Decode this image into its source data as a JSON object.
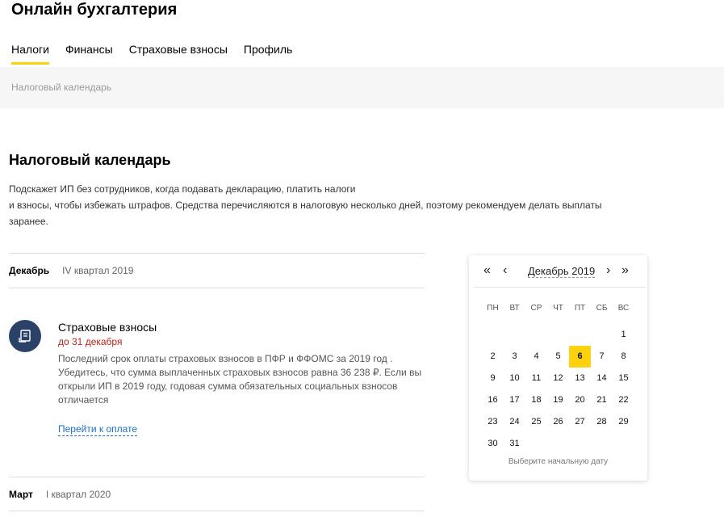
{
  "app": {
    "title": "Онлайн бухгалтерия"
  },
  "tabs": [
    {
      "label": "Налоги",
      "active": true
    },
    {
      "label": "Финансы"
    },
    {
      "label": "Страховые взносы"
    },
    {
      "label": "Профиль"
    }
  ],
  "breadcrumb": "Налоговый календарь",
  "page": {
    "title": "Налоговый календарь",
    "intro_line1": "Подскажет ИП без сотрудников, когда подавать декларацию, платить налоги",
    "intro_line2": "и взносы, чтобы избежать штрафов. Средства перечисляются в налоговую несколько дней, поэтому рекомендуем делать выплаты",
    "intro_line3": "заранее."
  },
  "periods": [
    {
      "month": "Декабрь",
      "quarter": "IV квартал 2019"
    },
    {
      "month": "Март",
      "quarter": "I квартал 2020"
    }
  ],
  "event": {
    "icon": "document-icon",
    "title": "Страховые взносы",
    "deadline": "до 31 декабря",
    "desc_line1": "Последний срок оплаты страховых взносов в ПФР и ФФОМС за 2019 год .",
    "desc_line2": "Убедитесь, что сумма выплаченных страховых взносов равна 36 238 ₽. Если вы",
    "desc_line3": "открыли ИП в 2019 году, годовая сумма обязательных социальных взносов",
    "desc_line4": "отличается",
    "link": "Перейти к оплате"
  },
  "calendar": {
    "month_label": "Декабрь 2019",
    "prev_year": "«",
    "prev_month": "‹",
    "next_month": "›",
    "next_year": "»",
    "weekdays": [
      "ПН",
      "ВТ",
      "СР",
      "ЧТ",
      "ПТ",
      "СБ",
      "ВС"
    ],
    "days": [
      "",
      "",
      "",
      "",
      "",
      "",
      "1",
      "2",
      "3",
      "4",
      "5",
      "6",
      "7",
      "8",
      "9",
      "10",
      "11",
      "12",
      "13",
      "14",
      "15",
      "16",
      "17",
      "18",
      "19",
      "20",
      "21",
      "22",
      "23",
      "24",
      "25",
      "26",
      "27",
      "28",
      "29",
      "30",
      "31"
    ],
    "selected": "6",
    "hint": "Выберите начальную дату"
  },
  "colors": {
    "accent": "#fdd10b",
    "deadline": "#c0201a",
    "link": "#1a6fc7",
    "icon_bg": "#2a4267"
  }
}
